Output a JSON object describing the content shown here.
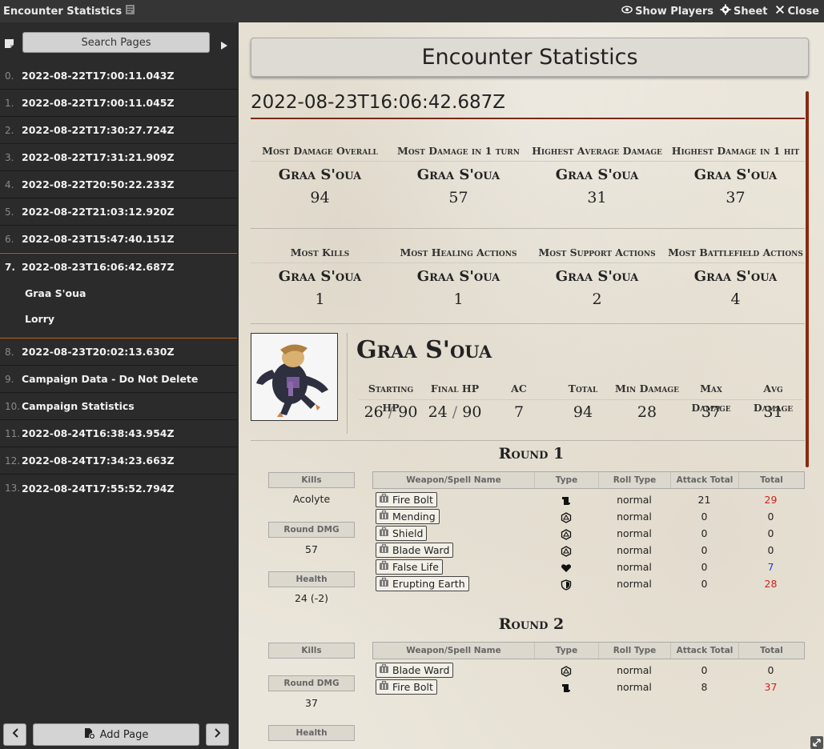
{
  "window": {
    "title": "Encounter Statistics",
    "show_players": "Show Players",
    "sheet": "Sheet",
    "close": "Close"
  },
  "sidebar": {
    "search_label": "Search Pages",
    "pages": [
      {
        "num": "0.",
        "label": "2022-08-22T17:00:11.043Z"
      },
      {
        "num": "1.",
        "label": "2022-08-22T17:00:11.045Z"
      },
      {
        "num": "2.",
        "label": "2022-08-22T17:30:27.724Z"
      },
      {
        "num": "3.",
        "label": "2022-08-22T17:31:21.909Z"
      },
      {
        "num": "4.",
        "label": "2022-08-22T20:50:22.233Z"
      },
      {
        "num": "5.",
        "label": "2022-08-22T21:03:12.920Z"
      },
      {
        "num": "6.",
        "label": "2022-08-23T15:47:40.151Z"
      },
      {
        "num": "7.",
        "label": "2022-08-23T16:06:42.687Z"
      },
      {
        "num": "8.",
        "label": "2022-08-23T20:02:13.630Z"
      },
      {
        "num": "9.",
        "label": "Campaign Data - Do Not Delete"
      },
      {
        "num": "10.",
        "label": "Campaign Statistics"
      },
      {
        "num": "11.",
        "label": "2022-08-24T16:38:43.954Z"
      },
      {
        "num": "12.",
        "label": "2022-08-24T17:34:23.663Z"
      },
      {
        "num": "13.",
        "label": "2022-08-24T17:55:52.794Z"
      }
    ],
    "sub_pages": [
      "Graa S'oua",
      "Lorry"
    ],
    "add_page": "Add Page"
  },
  "main": {
    "header": "Encounter Statistics",
    "timestamp": "2022-08-23T16:06:42.687Z",
    "top_stats": [
      {
        "label": "Most Damage Overall",
        "name": "Graa S'oua",
        "value": "94"
      },
      {
        "label": "Most Damage in 1 turn",
        "name": "Graa S'oua",
        "value": "57"
      },
      {
        "label": "Highest Average Damage",
        "name": "Graa S'oua",
        "value": "31"
      },
      {
        "label": "Highest Damage in 1 hit",
        "name": "Graa S'oua",
        "value": "37"
      }
    ],
    "action_stats": [
      {
        "label": "Most Kills",
        "name": "Graa S'oua",
        "value": "1"
      },
      {
        "label": "Most Healing Actions",
        "name": "Graa S'oua",
        "value": "1"
      },
      {
        "label": "Most Support Actions",
        "name": "Graa S'oua",
        "value": "2"
      },
      {
        "label": "Most Battlefield Actions",
        "name": "Graa S'oua",
        "value": "4"
      }
    ],
    "character": {
      "name": "Graa S'oua",
      "labels": [
        "Starting HP",
        "Final HP",
        "AC",
        "Total",
        "Min Damage",
        "Max Damage",
        "Avg Damage"
      ],
      "starting_hp": "26",
      "starting_hp_max": "90",
      "final_hp": "24",
      "final_hp_max": "90",
      "ac": "7",
      "total": "94",
      "min_damage": "28",
      "max_damage": "37",
      "avg_damage": "31"
    },
    "table_headers": [
      "Weapon/Spell Name",
      "Type",
      "Roll Type",
      "Attack Total",
      "Total"
    ],
    "side_labels": {
      "kills": "Kills",
      "round_dmg": "Round DMG",
      "health": "Health"
    },
    "rounds": [
      {
        "title": "Round 1",
        "kills": "Acolyte",
        "round_dmg": "57",
        "health": "24 (-2)",
        "rows": [
          {
            "name": "Fire Bolt",
            "type_icon": "scroll-icon",
            "roll": "normal",
            "attack": "21",
            "total": "29",
            "total_color": "red"
          },
          {
            "name": "Mending",
            "type_icon": "d20-icon",
            "roll": "normal",
            "attack": "0",
            "total": "0",
            "total_color": "black"
          },
          {
            "name": "Shield",
            "type_icon": "d20-icon",
            "roll": "normal",
            "attack": "0",
            "total": "0",
            "total_color": "black"
          },
          {
            "name": "Blade Ward",
            "type_icon": "d20-icon",
            "roll": "normal",
            "attack": "0",
            "total": "0",
            "total_color": "black"
          },
          {
            "name": "False Life",
            "type_icon": "heart-icon",
            "roll": "normal",
            "attack": "0",
            "total": "7",
            "total_color": "blue"
          },
          {
            "name": "Erupting Earth",
            "type_icon": "shield-icon",
            "roll": "normal",
            "attack": "0",
            "total": "28",
            "total_color": "red"
          }
        ]
      },
      {
        "title": "Round 2",
        "round_dmg": "37",
        "rows": [
          {
            "name": "Blade Ward",
            "type_icon": "d20-icon",
            "roll": "normal",
            "attack": "0",
            "total": "0",
            "total_color": "black"
          },
          {
            "name": "Fire Bolt",
            "type_icon": "scroll-icon",
            "roll": "normal",
            "attack": "8",
            "total": "37",
            "total_color": "red"
          }
        ]
      }
    ]
  },
  "colors": {
    "accent_orange": "#c0601a",
    "accent_dark_red": "#7a2a1a",
    "damage_red": "#d02020",
    "heal_blue": "#2040d0",
    "parchment": "#ebe6db"
  }
}
